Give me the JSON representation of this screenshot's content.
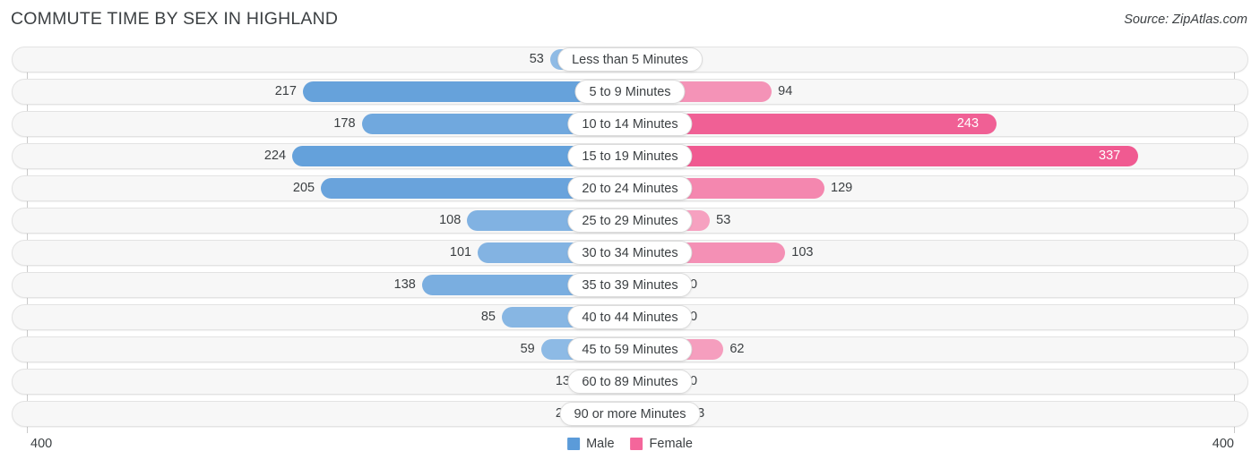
{
  "header": {
    "title": "COMMUTE TIME BY SEX IN HIGHLAND",
    "source": "Source: ZipAtlas.com"
  },
  "footer": {
    "left_tick": "400",
    "right_tick": "400",
    "legend": [
      {
        "label": "Male",
        "color": "#5B9BD9"
      },
      {
        "label": "Female",
        "color": "#F4669B"
      }
    ]
  },
  "chart_data": {
    "type": "bar",
    "subtype": "diverging-bidirectional",
    "title": "COMMUTE TIME BY SEX IN HIGHLAND",
    "xlabel": "",
    "ylabel": "",
    "axis_max": 400,
    "axis_min": 0,
    "left_axis_label": "400",
    "right_axis_label": "400",
    "grid": false,
    "legend_position": "bottom-center",
    "categories": [
      "Less than 5 Minutes",
      "5 to 9 Minutes",
      "10 to 14 Minutes",
      "15 to 19 Minutes",
      "20 to 24 Minutes",
      "25 to 29 Minutes",
      "30 to 34 Minutes",
      "35 to 39 Minutes",
      "40 to 44 Minutes",
      "45 to 59 Minutes",
      "60 to 89 Minutes",
      "90 or more Minutes"
    ],
    "series": [
      {
        "name": "Male",
        "color": "#5B9BD9",
        "direction": "left",
        "values": [
          53,
          217,
          178,
          224,
          205,
          108,
          101,
          138,
          85,
          59,
          13,
          28
        ]
      },
      {
        "name": "Female",
        "color": "#F4669B",
        "direction": "right",
        "values": [
          0,
          94,
          243,
          337,
          129,
          53,
          103,
          0,
          0,
          62,
          0,
          13
        ]
      }
    ]
  }
}
